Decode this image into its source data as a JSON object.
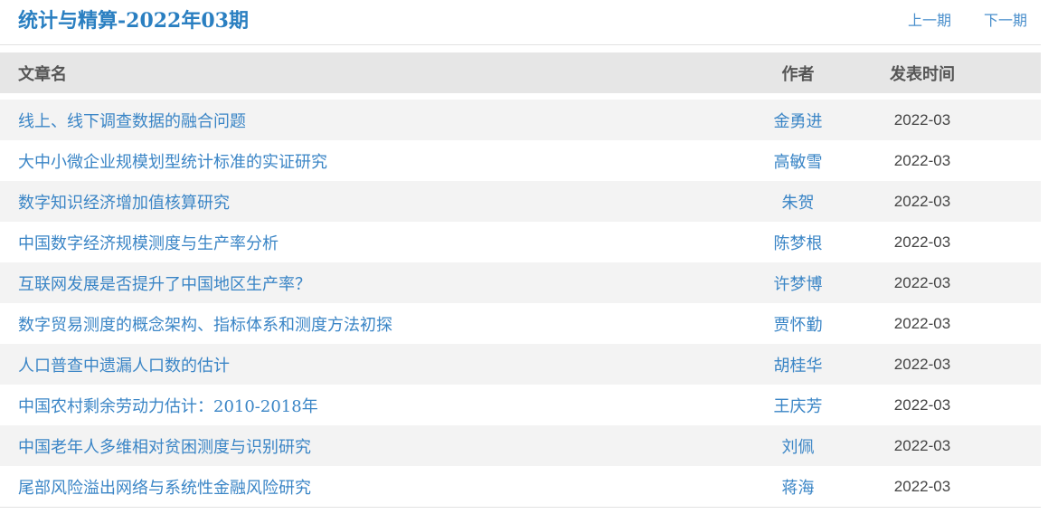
{
  "header": {
    "title": "统计与精算-2022年03期",
    "prev_label": "上一期",
    "next_label": "下一期"
  },
  "table": {
    "columns": {
      "title": "文章名",
      "author": "作者",
      "date": "发表时间"
    },
    "rows": [
      {
        "title": "线上、线下调查数据的融合问题",
        "author": "金勇进",
        "date": "2022-03"
      },
      {
        "title": "大中小微企业规模划型统计标准的实证研究",
        "author": "高敏雪",
        "date": "2022-03"
      },
      {
        "title": "数字知识经济增加值核算研究",
        "author": "朱贺",
        "date": "2022-03"
      },
      {
        "title": "中国数字经济规模测度与生产率分析",
        "author": "陈梦根",
        "date": "2022-03"
      },
      {
        "title": "互联网发展是否提升了中国地区生产率？",
        "author": "许梦博",
        "date": "2022-03"
      },
      {
        "title": "数字贸易测度的概念架构、指标体系和测度方法初探",
        "author": "贾怀勤",
        "date": "2022-03"
      },
      {
        "title": "人口普查中遗漏人口数的估计",
        "author": "胡桂华",
        "date": "2022-03"
      },
      {
        "title": "中国农村剩余劳动力估计：2010-2018年",
        "author": "王庆芳",
        "date": "2022-03"
      },
      {
        "title": "中国老年人多维相对贫困测度与识别研究",
        "author": "刘佩",
        "date": "2022-03"
      },
      {
        "title": "尾部风险溢出网络与系统性金融风险研究",
        "author": "蒋海",
        "date": "2022-03"
      }
    ]
  },
  "colors": {
    "title": "#2a7fc1",
    "link": "#3a85c6",
    "header_bg": "#e6e6e6",
    "stripe_bg": "#f3f3f3"
  }
}
